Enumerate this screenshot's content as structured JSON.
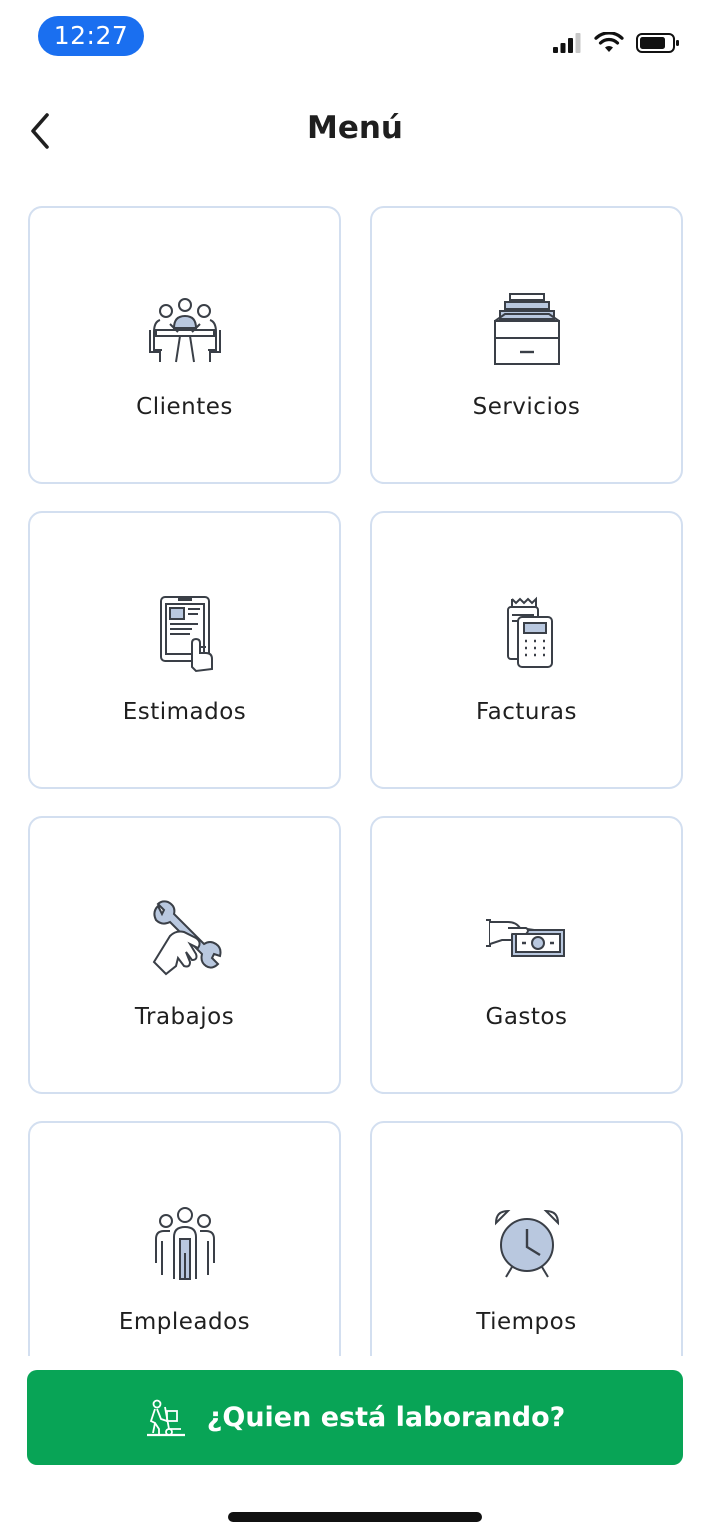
{
  "status_bar": {
    "time": "12:27"
  },
  "nav": {
    "title": "Menú",
    "back_icon": "chevron-left-icon"
  },
  "menu_items": [
    {
      "label": "Clientes",
      "icon": "clients-meeting-icon"
    },
    {
      "label": "Servicios",
      "icon": "file-drawer-icon"
    },
    {
      "label": "Estimados",
      "icon": "tablet-touch-icon"
    },
    {
      "label": "Facturas",
      "icon": "payment-terminal-icon"
    },
    {
      "label": "Trabajos",
      "icon": "wrench-hand-icon"
    },
    {
      "label": "Gastos",
      "icon": "hand-money-icon"
    },
    {
      "label": "Empleados",
      "icon": "employees-group-icon"
    },
    {
      "label": "Tiempos",
      "icon": "alarm-clock-icon"
    }
  ],
  "cta": {
    "label": "¿Quien está laborando?",
    "icon": "worker-hand-truck-icon"
  },
  "colors": {
    "accent_blue": "#1a6ff0",
    "cta_green": "#08a456",
    "tile_border": "#d3dff0",
    "icon_fill": "#b9c8df"
  }
}
